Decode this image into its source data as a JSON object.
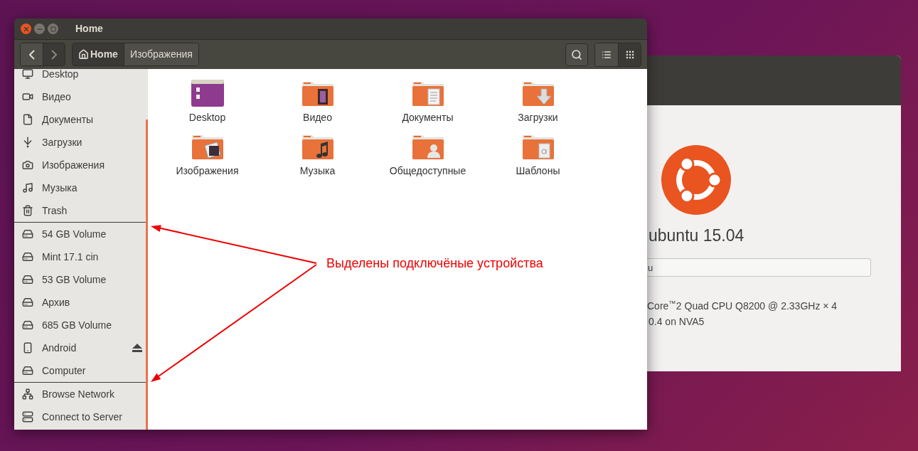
{
  "window": {
    "title": "Home"
  },
  "toolbar": {
    "nav_buttons": [
      {
        "kind": "back",
        "disabled": false
      },
      {
        "kind": "forward",
        "disabled": true
      }
    ],
    "path": [
      {
        "label": "Home",
        "kind": "home",
        "selected": true
      },
      {
        "label": "Изображения",
        "kind": "folder",
        "selected": false
      }
    ],
    "view_buttons": [
      {
        "kind": "list",
        "selected": false
      },
      {
        "kind": "grid",
        "selected": true
      }
    ]
  },
  "sidebar": {
    "sections": [
      {
        "items": [
          {
            "label": "Desktop",
            "kind": "desktop"
          },
          {
            "label": "Видео",
            "kind": "video"
          },
          {
            "label": "Документы",
            "kind": "document"
          },
          {
            "label": "Загрузки",
            "kind": "download"
          },
          {
            "label": "Изображения",
            "kind": "camera"
          },
          {
            "label": "Музыка",
            "kind": "music"
          },
          {
            "label": "Trash",
            "kind": "trash"
          }
        ]
      },
      {
        "items": [
          {
            "label": "54 GB Volume",
            "kind": "drive",
            "ejectable": false
          },
          {
            "label": "Mint 17.1 cin",
            "kind": "drive",
            "ejectable": false
          },
          {
            "label": "53 GB Volume",
            "kind": "drive",
            "ejectable": false
          },
          {
            "label": "Архив",
            "kind": "drive",
            "ejectable": false
          },
          {
            "label": "685 GB Volume",
            "kind": "drive",
            "ejectable": false
          },
          {
            "label": "Android",
            "kind": "phone",
            "ejectable": true
          },
          {
            "label": "Computer",
            "kind": "drive",
            "ejectable": false
          }
        ]
      },
      {
        "items": [
          {
            "label": "Browse Network",
            "kind": "network"
          },
          {
            "label": "Connect to Server",
            "kind": "server"
          }
        ]
      }
    ]
  },
  "files": [
    {
      "name": "Desktop",
      "kind": "desktop"
    },
    {
      "name": "Видео",
      "kind": "video"
    },
    {
      "name": "Документы",
      "kind": "document"
    },
    {
      "name": "Загрузки",
      "kind": "download"
    },
    {
      "name": "Изображения",
      "kind": "pictures"
    },
    {
      "name": "Музыка",
      "kind": "music"
    },
    {
      "name": "Общедоступные",
      "kind": "public"
    },
    {
      "name": "Шаблоны",
      "kind": "templates"
    }
  ],
  "about_window": {
    "os_name": "ubuntu 15.04",
    "field_value": "u",
    "processor": "Core$^{™}$2 Quad CPU Q8200 @ 2.33GHz × 4",
    "graphics": "0.4 on NVA5"
  },
  "annotation": {
    "text": "Выделены подключёные устройства"
  }
}
